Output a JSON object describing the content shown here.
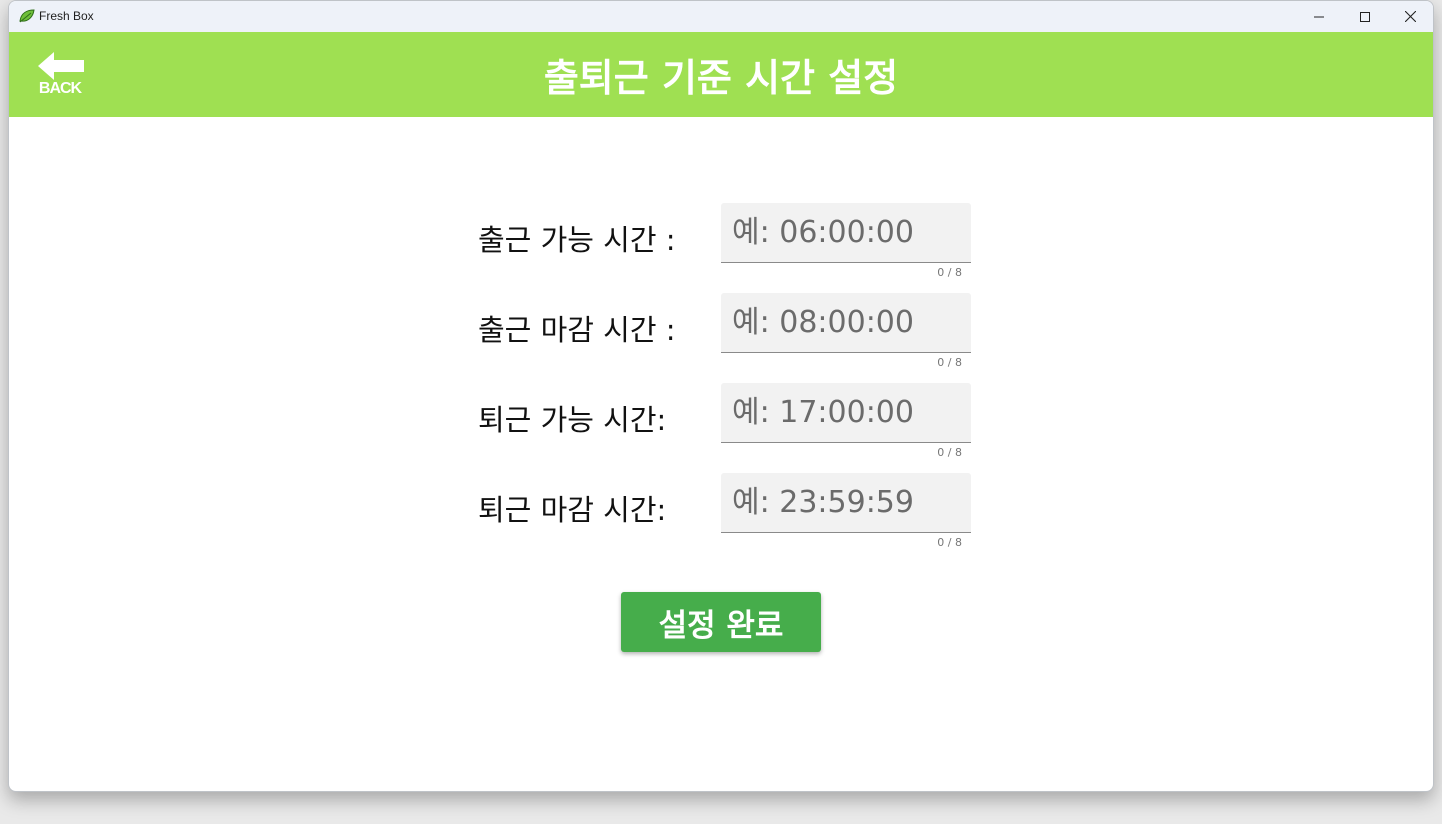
{
  "window": {
    "title": "Fresh Box"
  },
  "header": {
    "back_label": "BACK",
    "title": "출퇴근 기준 시간 설정"
  },
  "form": {
    "fields": [
      {
        "label": "출근 가능 시간 :",
        "placeholder": "예: 06:00:00",
        "value": "",
        "counter": "0 / 8"
      },
      {
        "label": "출근 마감 시간 :",
        "placeholder": "예: 08:00:00",
        "value": "",
        "counter": "0 / 8"
      },
      {
        "label": "퇴근 가능 시간:",
        "placeholder": "예: 17:00:00",
        "value": "",
        "counter": "0 / 8"
      },
      {
        "label": "퇴근 마감 시간:",
        "placeholder": "예: 23:59:59",
        "value": "",
        "counter": "0 / 8"
      }
    ],
    "submit_label": "설정 완료"
  },
  "icons": {
    "app": "leaf-icon",
    "back": "arrow-left-icon",
    "minimize": "minimize-icon",
    "maximize": "maximize-icon",
    "close": "close-icon"
  },
  "colors": {
    "header_bg": "#9fe052",
    "button_bg": "#46ad4b",
    "titlebar_bg": "#eef2f9"
  }
}
